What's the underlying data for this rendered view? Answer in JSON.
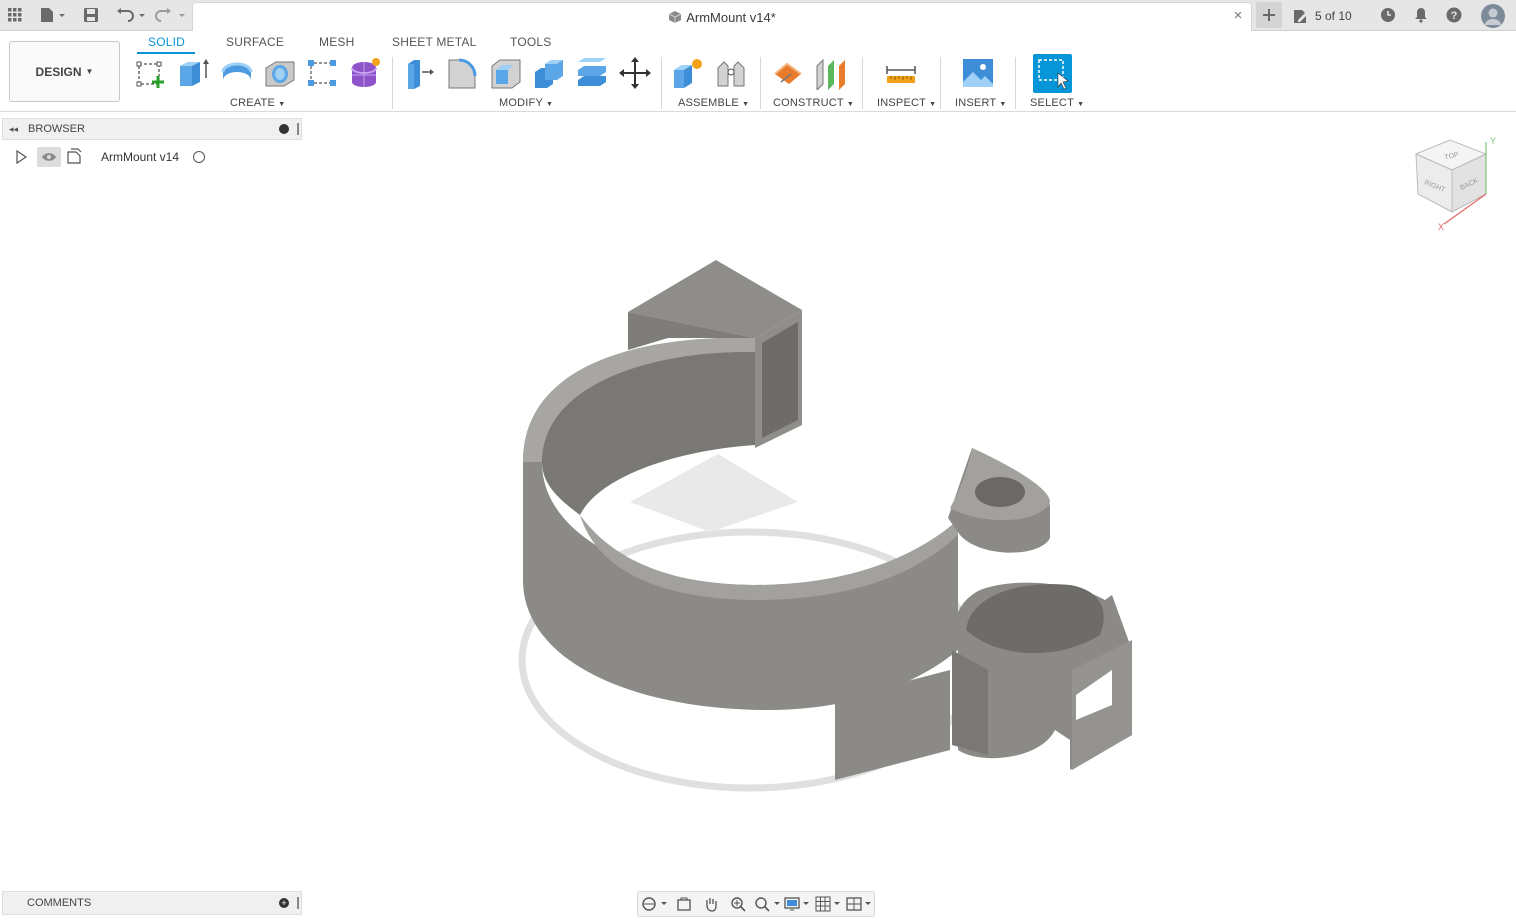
{
  "topbar": {
    "doc_title": "ArmMount v14*",
    "version_counter": "5 of 10"
  },
  "toolbar": {
    "workspace_label": "DESIGN",
    "tabs": [
      {
        "label": "SOLID",
        "active": true
      },
      {
        "label": "SURFACE",
        "active": false
      },
      {
        "label": "MESH",
        "active": false
      },
      {
        "label": "SHEET METAL",
        "active": false
      },
      {
        "label": "TOOLS",
        "active": false
      }
    ],
    "groups": {
      "create": "CREATE",
      "modify": "MODIFY",
      "assemble": "ASSEMBLE",
      "construct": "CONSTRUCT",
      "inspect": "INSPECT",
      "insert": "INSERT",
      "select": "SELECT"
    },
    "accent_color": "#0696d7"
  },
  "browser": {
    "title": "BROWSER",
    "root_item": "ArmMount v14"
  },
  "comments": {
    "title": "COMMENTS"
  },
  "viewcube": {
    "faces": [
      "TOP",
      "RIGHT",
      "BACK"
    ],
    "axes": [
      "Y",
      "X"
    ]
  }
}
